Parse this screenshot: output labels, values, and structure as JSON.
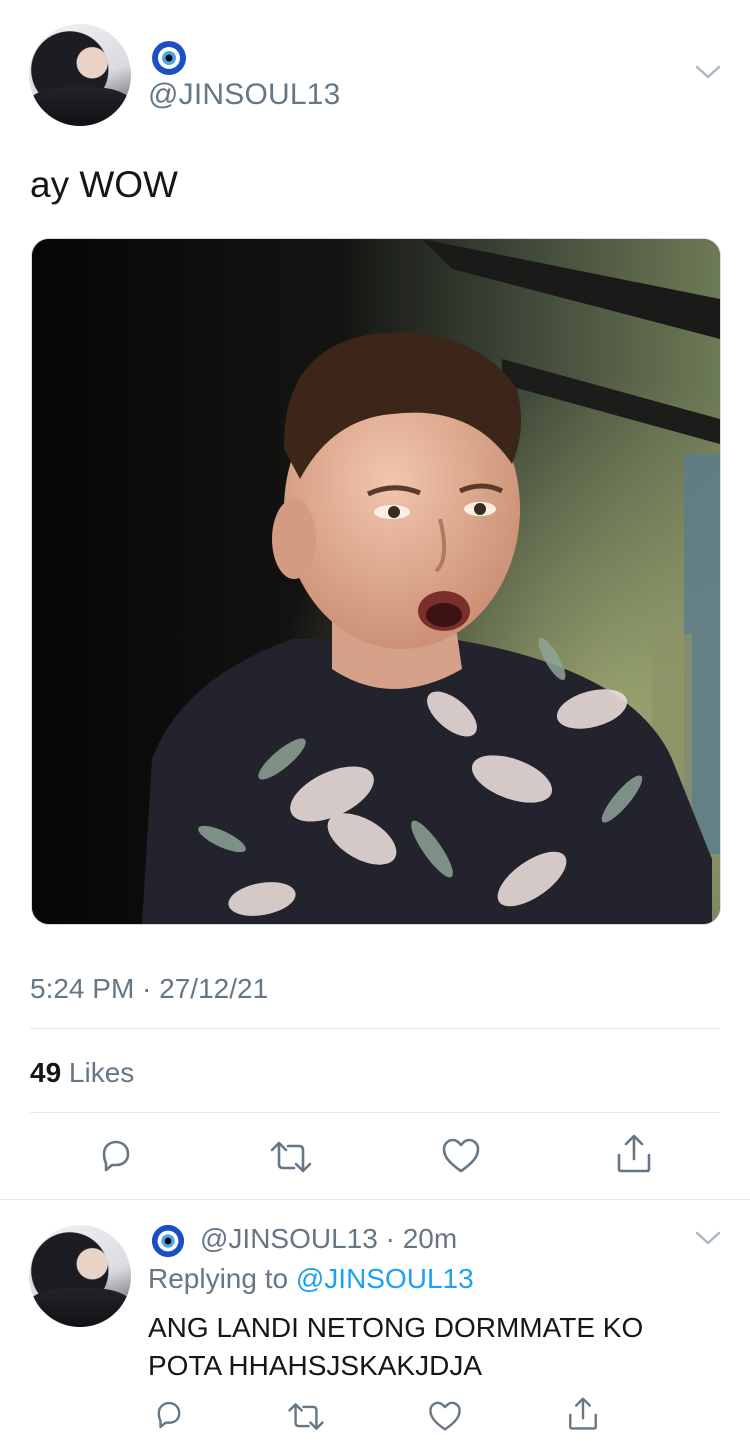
{
  "tweet": {
    "handle": "@JINSOUL13",
    "badge_icon": "nazar-evil-eye",
    "text": "ay WOW",
    "timestamp": "5:24 PM · 27/12/21",
    "likes_count": "49",
    "likes_label": " Likes"
  },
  "reply": {
    "handle": "@JINSOUL13",
    "time": " · 20m",
    "replying_prefix": "Replying to ",
    "replying_to": "@JINSOUL13",
    "text": "ANG LANDI NETONG DORMMATE KO POTA HHAHSJSKAKJDJA"
  },
  "icons": [
    "chevron-down-icon",
    "reply-icon",
    "retweet-icon",
    "like-icon",
    "share-icon"
  ],
  "colors": {
    "accent": "#1da1f2",
    "secondary_text": "#657786",
    "divider": "#e1e8ed"
  }
}
